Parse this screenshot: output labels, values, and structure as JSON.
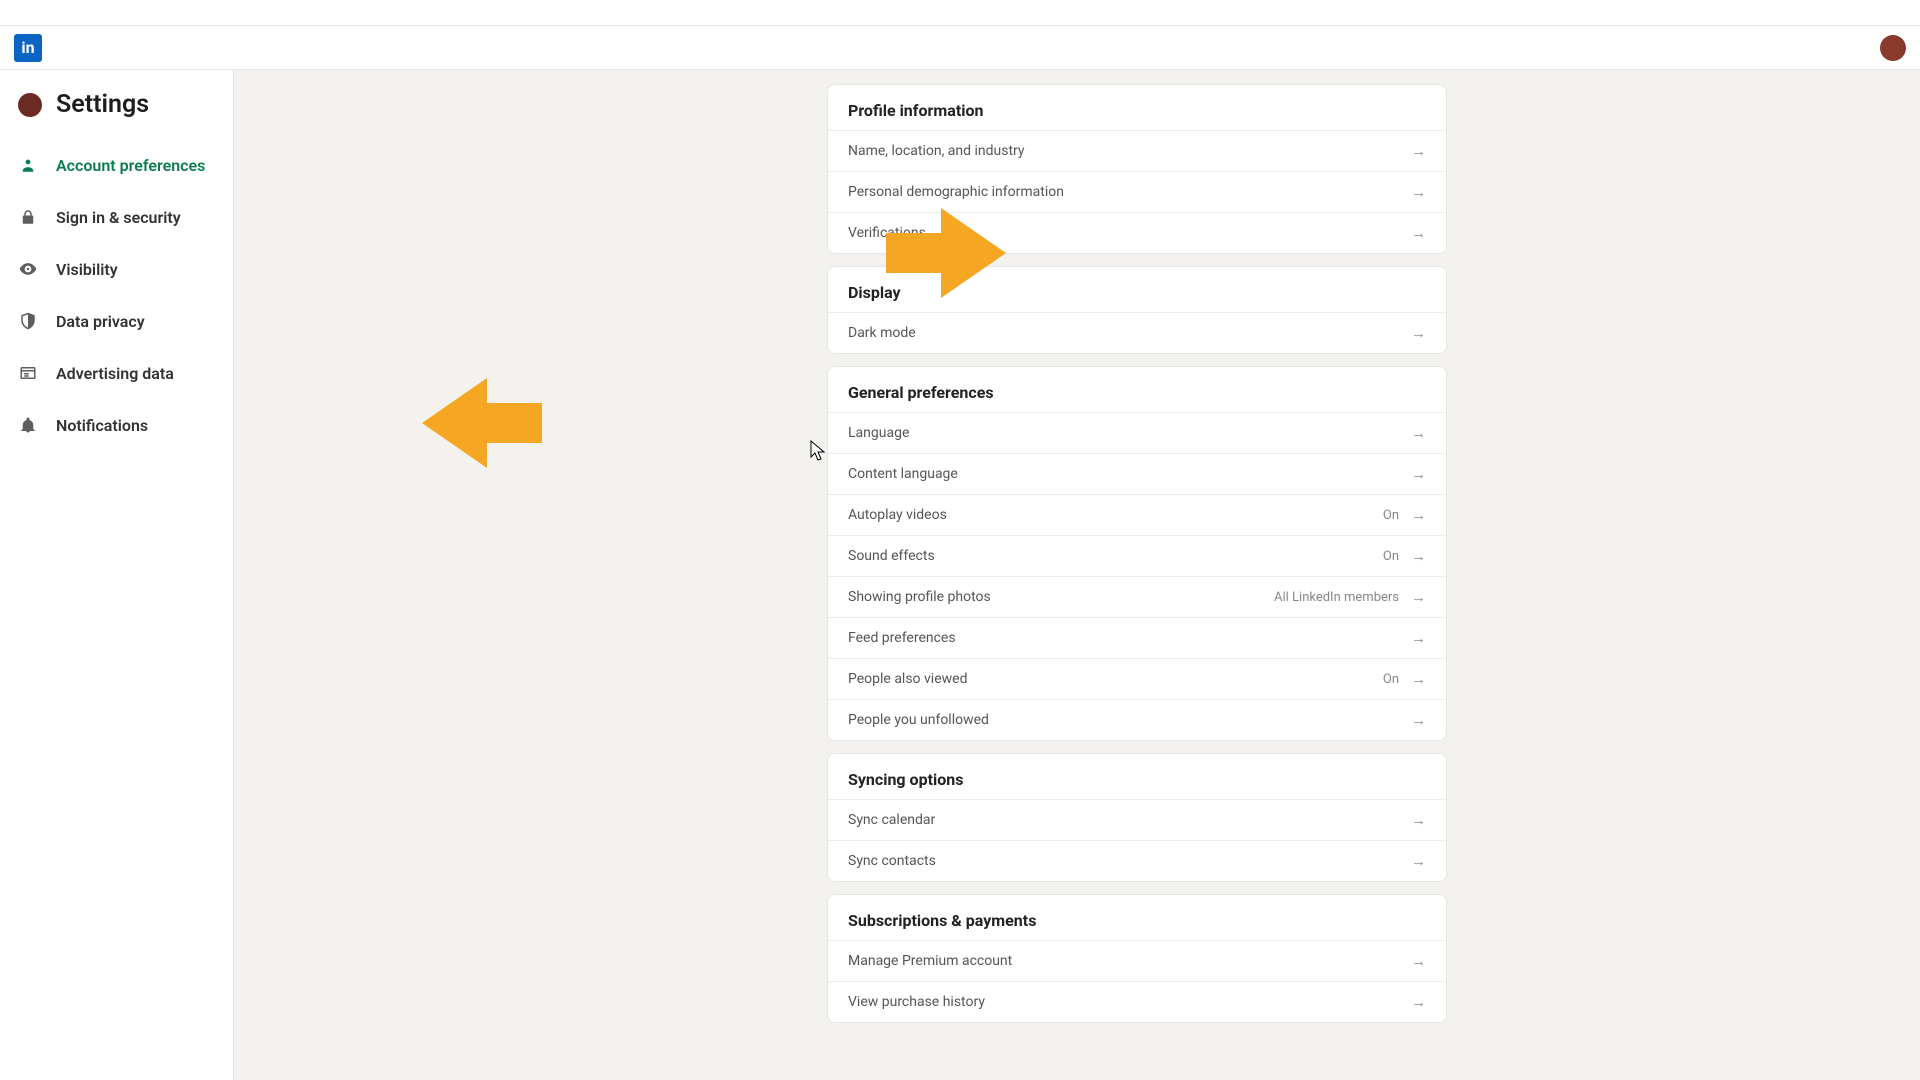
{
  "brand": {
    "logo_text": "in"
  },
  "page_title": "Settings",
  "sidebar": {
    "items": [
      {
        "id": "account-preferences",
        "label": "Account preferences",
        "active": true
      },
      {
        "id": "signin-security",
        "label": "Sign in & security"
      },
      {
        "id": "visibility",
        "label": "Visibility"
      },
      {
        "id": "data-privacy",
        "label": "Data privacy"
      },
      {
        "id": "advertising-data",
        "label": "Advertising data"
      },
      {
        "id": "notifications",
        "label": "Notifications"
      }
    ]
  },
  "sections": [
    {
      "id": "profile-information",
      "title": "Profile information",
      "rows": [
        {
          "id": "name-location-industry",
          "label": "Name, location, and industry"
        },
        {
          "id": "personal-demographic",
          "label": "Personal demographic information"
        },
        {
          "id": "verifications",
          "label": "Verifications"
        }
      ]
    },
    {
      "id": "display",
      "title": "Display",
      "rows": [
        {
          "id": "dark-mode",
          "label": "Dark mode"
        }
      ]
    },
    {
      "id": "general-preferences",
      "title": "General preferences",
      "rows": [
        {
          "id": "language",
          "label": "Language"
        },
        {
          "id": "content-language",
          "label": "Content language"
        },
        {
          "id": "autoplay-videos",
          "label": "Autoplay videos",
          "value": "On"
        },
        {
          "id": "sound-effects",
          "label": "Sound effects",
          "value": "On"
        },
        {
          "id": "profile-photos",
          "label": "Showing profile photos",
          "value": "All LinkedIn members"
        },
        {
          "id": "feed-preferences",
          "label": "Feed preferences"
        },
        {
          "id": "people-also-viewed",
          "label": "People also viewed",
          "value": "On"
        },
        {
          "id": "people-unfollowed",
          "label": "People you unfollowed"
        }
      ]
    },
    {
      "id": "syncing-options",
      "title": "Syncing options",
      "rows": [
        {
          "id": "sync-calendar",
          "label": "Sync calendar"
        },
        {
          "id": "sync-contacts",
          "label": "Sync contacts"
        }
      ]
    },
    {
      "id": "subscriptions-payments",
      "title": "Subscriptions & payments",
      "rows": [
        {
          "id": "manage-premium",
          "label": "Manage Premium account"
        },
        {
          "id": "purchase-history",
          "label": "View purchase history"
        }
      ]
    }
  ],
  "annotations": {
    "arrow_color": "#f5a623"
  }
}
